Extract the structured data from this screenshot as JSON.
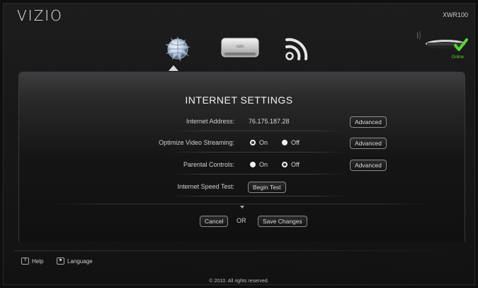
{
  "header": {
    "logo": "VIZIO",
    "model": "XWR100"
  },
  "device_status": {
    "label": "Online",
    "color": "#58d23a"
  },
  "nav": {
    "icons": [
      "globe-icon",
      "router-icon",
      "wifi-icon"
    ]
  },
  "settings": {
    "title": "INTERNET SETTINGS",
    "internet_address": {
      "label": "Internet Address:",
      "value": "76.175.187.28",
      "advanced": "Advanced"
    },
    "optimize_video": {
      "label": "Optimize Video Streaming:",
      "on": "On",
      "off": "Off",
      "selected": "On",
      "advanced": "Advanced"
    },
    "parental": {
      "label": "Parental Controls:",
      "on": "On",
      "off": "Off",
      "selected": "Off",
      "advanced": "Advanced"
    },
    "speed_test": {
      "label": "Internet Speed Test:",
      "button": "Begin Test"
    }
  },
  "actions": {
    "cancel": "Cancel",
    "or": "OR",
    "save": "Save Changes"
  },
  "footer": {
    "help": "Help",
    "language": "Language",
    "copyright": "© 2010. All rights reserved."
  }
}
